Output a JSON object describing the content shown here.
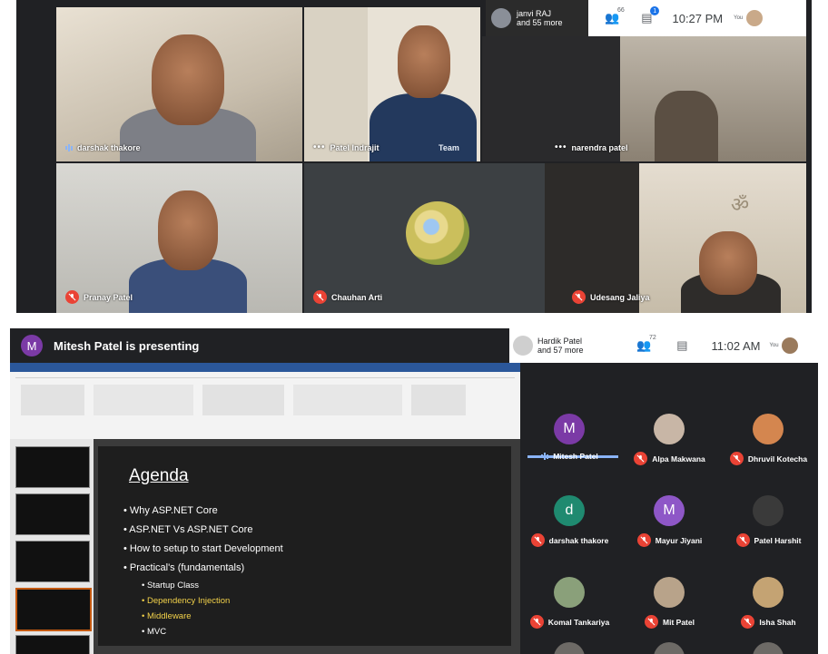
{
  "top_call": {
    "participants_summary": {
      "name": "janvi RAJ",
      "more": "and 55 more"
    },
    "people_count": "66",
    "chat_badge": "1",
    "time": "10:27 PM",
    "you_label": "You",
    "tiles": [
      {
        "name": "darshak thakore",
        "status": "speaking"
      },
      {
        "name": "Patel Indrajit",
        "status": "more"
      },
      {
        "name": "narendra patel",
        "status": "more"
      },
      {
        "name": "Pranay Patel",
        "status": "muted"
      },
      {
        "name": "Chauhan Arti",
        "status": "muted"
      },
      {
        "name": "Udesang Jaliya",
        "status": "muted"
      }
    ],
    "shirt_text": "Team"
  },
  "bottom_call": {
    "presenter_initial": "M",
    "presenting_title": "Mitesh Patel is presenting",
    "participants_summary": {
      "name": "Hardik Patel",
      "more": "and 57 more"
    },
    "people_count": "72",
    "time": "11:02 AM",
    "you_label": "You",
    "slide": {
      "title": "Agenda",
      "bullets": [
        "• Why ASP.NET Core",
        "• ASP.NET Vs ASP.NET Core",
        "• How to setup to start Development",
        "• Practical's (fundamentals)"
      ],
      "sub_bullets": [
        {
          "text": "• Startup Class",
          "highlight": false
        },
        {
          "text": "• Dependency Injection",
          "highlight": true
        },
        {
          "text": "• Middleware",
          "highlight": true
        },
        {
          "text": "• MVC",
          "highlight": false
        }
      ]
    },
    "participants": [
      {
        "name": "Mitesh Patel",
        "initial": "M",
        "avatar_color": "#7b3aa6",
        "status": "speaking"
      },
      {
        "name": "Alpa Makwana",
        "initial": "",
        "avatar_color": "#c8b6a6",
        "status": "muted"
      },
      {
        "name": "Dhruvil Kotecha",
        "initial": "",
        "avatar_color": "#d4864f",
        "status": "muted"
      },
      {
        "name": "darshak thakore",
        "initial": "d",
        "avatar_color": "#1f8a70",
        "status": "muted"
      },
      {
        "name": "Mayur Jiyani",
        "initial": "M",
        "avatar_color": "#8e57c7",
        "status": "muted"
      },
      {
        "name": "Patel Harshit",
        "initial": "",
        "avatar_color": "#3a3a3a",
        "status": "muted"
      },
      {
        "name": "Komal Tankariya",
        "initial": "",
        "avatar_color": "#8aa07a",
        "status": "muted"
      },
      {
        "name": "Mit Patel",
        "initial": "",
        "avatar_color": "#b8a38a",
        "status": "muted"
      },
      {
        "name": "Isha Shah",
        "initial": "",
        "avatar_color": "#c4a373",
        "status": "muted"
      }
    ]
  },
  "colors": {
    "dark_bg": "#202124",
    "mute_red": "#ea4335",
    "accent_blue": "#8ab4f8",
    "slide_yellow": "#f2d14a"
  }
}
